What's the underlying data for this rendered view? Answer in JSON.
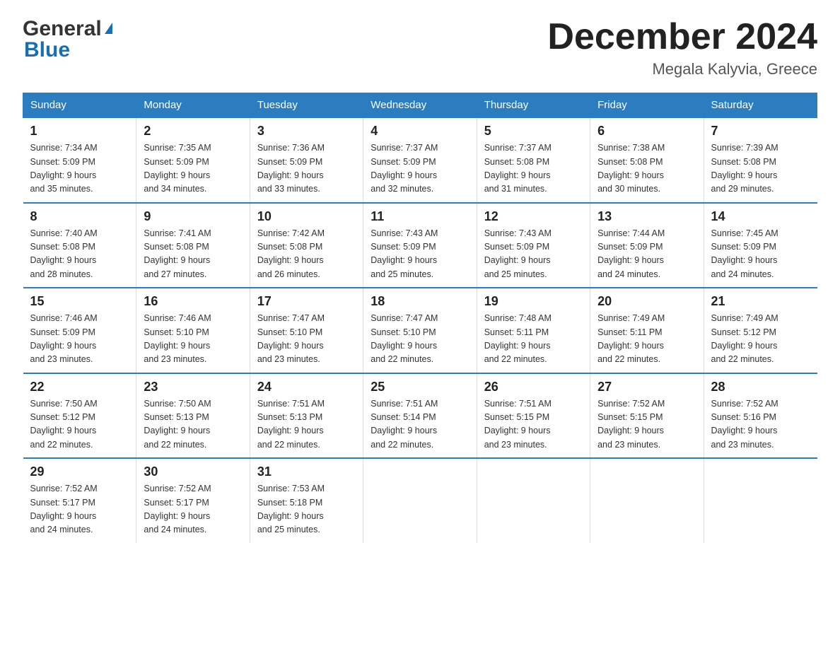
{
  "header": {
    "logo_general": "General",
    "logo_blue": "Blue",
    "month_title": "December 2024",
    "location": "Megala Kalyvia, Greece"
  },
  "days_of_week": [
    "Sunday",
    "Monday",
    "Tuesday",
    "Wednesday",
    "Thursday",
    "Friday",
    "Saturday"
  ],
  "weeks": [
    [
      {
        "day": "1",
        "sunrise": "7:34 AM",
        "sunset": "5:09 PM",
        "daylight": "9 hours and 35 minutes."
      },
      {
        "day": "2",
        "sunrise": "7:35 AM",
        "sunset": "5:09 PM",
        "daylight": "9 hours and 34 minutes."
      },
      {
        "day": "3",
        "sunrise": "7:36 AM",
        "sunset": "5:09 PM",
        "daylight": "9 hours and 33 minutes."
      },
      {
        "day": "4",
        "sunrise": "7:37 AM",
        "sunset": "5:09 PM",
        "daylight": "9 hours and 32 minutes."
      },
      {
        "day": "5",
        "sunrise": "7:37 AM",
        "sunset": "5:08 PM",
        "daylight": "9 hours and 31 minutes."
      },
      {
        "day": "6",
        "sunrise": "7:38 AM",
        "sunset": "5:08 PM",
        "daylight": "9 hours and 30 minutes."
      },
      {
        "day": "7",
        "sunrise": "7:39 AM",
        "sunset": "5:08 PM",
        "daylight": "9 hours and 29 minutes."
      }
    ],
    [
      {
        "day": "8",
        "sunrise": "7:40 AM",
        "sunset": "5:08 PM",
        "daylight": "9 hours and 28 minutes."
      },
      {
        "day": "9",
        "sunrise": "7:41 AM",
        "sunset": "5:08 PM",
        "daylight": "9 hours and 27 minutes."
      },
      {
        "day": "10",
        "sunrise": "7:42 AM",
        "sunset": "5:08 PM",
        "daylight": "9 hours and 26 minutes."
      },
      {
        "day": "11",
        "sunrise": "7:43 AM",
        "sunset": "5:09 PM",
        "daylight": "9 hours and 25 minutes."
      },
      {
        "day": "12",
        "sunrise": "7:43 AM",
        "sunset": "5:09 PM",
        "daylight": "9 hours and 25 minutes."
      },
      {
        "day": "13",
        "sunrise": "7:44 AM",
        "sunset": "5:09 PM",
        "daylight": "9 hours and 24 minutes."
      },
      {
        "day": "14",
        "sunrise": "7:45 AM",
        "sunset": "5:09 PM",
        "daylight": "9 hours and 24 minutes."
      }
    ],
    [
      {
        "day": "15",
        "sunrise": "7:46 AM",
        "sunset": "5:09 PM",
        "daylight": "9 hours and 23 minutes."
      },
      {
        "day": "16",
        "sunrise": "7:46 AM",
        "sunset": "5:10 PM",
        "daylight": "9 hours and 23 minutes."
      },
      {
        "day": "17",
        "sunrise": "7:47 AM",
        "sunset": "5:10 PM",
        "daylight": "9 hours and 23 minutes."
      },
      {
        "day": "18",
        "sunrise": "7:47 AM",
        "sunset": "5:10 PM",
        "daylight": "9 hours and 22 minutes."
      },
      {
        "day": "19",
        "sunrise": "7:48 AM",
        "sunset": "5:11 PM",
        "daylight": "9 hours and 22 minutes."
      },
      {
        "day": "20",
        "sunrise": "7:49 AM",
        "sunset": "5:11 PM",
        "daylight": "9 hours and 22 minutes."
      },
      {
        "day": "21",
        "sunrise": "7:49 AM",
        "sunset": "5:12 PM",
        "daylight": "9 hours and 22 minutes."
      }
    ],
    [
      {
        "day": "22",
        "sunrise": "7:50 AM",
        "sunset": "5:12 PM",
        "daylight": "9 hours and 22 minutes."
      },
      {
        "day": "23",
        "sunrise": "7:50 AM",
        "sunset": "5:13 PM",
        "daylight": "9 hours and 22 minutes."
      },
      {
        "day": "24",
        "sunrise": "7:51 AM",
        "sunset": "5:13 PM",
        "daylight": "9 hours and 22 minutes."
      },
      {
        "day": "25",
        "sunrise": "7:51 AM",
        "sunset": "5:14 PM",
        "daylight": "9 hours and 22 minutes."
      },
      {
        "day": "26",
        "sunrise": "7:51 AM",
        "sunset": "5:15 PM",
        "daylight": "9 hours and 23 minutes."
      },
      {
        "day": "27",
        "sunrise": "7:52 AM",
        "sunset": "5:15 PM",
        "daylight": "9 hours and 23 minutes."
      },
      {
        "day": "28",
        "sunrise": "7:52 AM",
        "sunset": "5:16 PM",
        "daylight": "9 hours and 23 minutes."
      }
    ],
    [
      {
        "day": "29",
        "sunrise": "7:52 AM",
        "sunset": "5:17 PM",
        "daylight": "9 hours and 24 minutes."
      },
      {
        "day": "30",
        "sunrise": "7:52 AM",
        "sunset": "5:17 PM",
        "daylight": "9 hours and 24 minutes."
      },
      {
        "day": "31",
        "sunrise": "7:53 AM",
        "sunset": "5:18 PM",
        "daylight": "9 hours and 25 minutes."
      },
      null,
      null,
      null,
      null
    ]
  ],
  "labels": {
    "sunrise": "Sunrise:",
    "sunset": "Sunset:",
    "daylight": "Daylight:"
  }
}
